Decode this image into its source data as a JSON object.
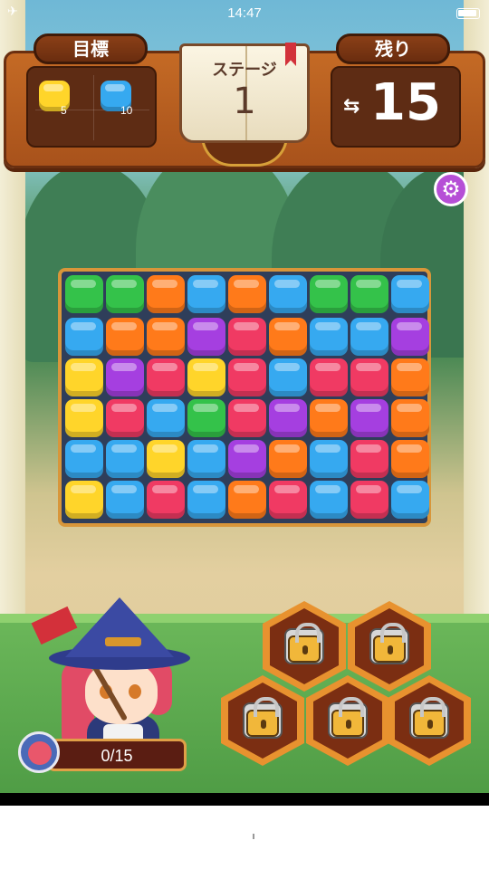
{
  "status_bar": {
    "time": "14:47"
  },
  "goal": {
    "title": "目標",
    "items": [
      {
        "color": "#ffd52a",
        "name": "yellow-cube",
        "count": "5"
      },
      {
        "color": "#36a9f0",
        "name": "blue-cube",
        "count": "10"
      }
    ]
  },
  "stage": {
    "label": "ステージ",
    "number": "1"
  },
  "moves": {
    "title": "残り",
    "arrows": "⇆",
    "value": "15"
  },
  "progress": {
    "text": "0/15",
    "fraction": 0
  },
  "colors": {
    "G": "#34c24a",
    "O": "#ff7a1a",
    "B": "#36a9f0",
    "P": "#a53fe0",
    "R": "#f03a63",
    "Y": "#ffd52a"
  },
  "board": {
    "rows": [
      [
        "G",
        "G",
        "O",
        "B",
        "O",
        "B",
        "G",
        "G",
        "B"
      ],
      [
        "B",
        "O",
        "O",
        "P",
        "R",
        "O",
        "B",
        "B",
        "P"
      ],
      [
        "Y",
        "P",
        "R",
        "Y",
        "R",
        "B",
        "R",
        "R",
        "O"
      ],
      [
        "Y",
        "R",
        "B",
        "G",
        "R",
        "P",
        "O",
        "P",
        "O"
      ],
      [
        "B",
        "B",
        "Y",
        "B",
        "P",
        "O",
        "B",
        "R",
        "O"
      ],
      [
        "Y",
        "B",
        "R",
        "B",
        "O",
        "R",
        "B",
        "R",
        "B"
      ]
    ]
  },
  "boosters": [
    {
      "name": "hammer-booster",
      "locked": true
    },
    {
      "name": "bomb-booster",
      "locked": true
    },
    {
      "name": "cross-booster",
      "locked": true
    },
    {
      "name": "shuffle-booster",
      "locked": true
    },
    {
      "name": "potion-booster",
      "locked": true
    }
  ]
}
